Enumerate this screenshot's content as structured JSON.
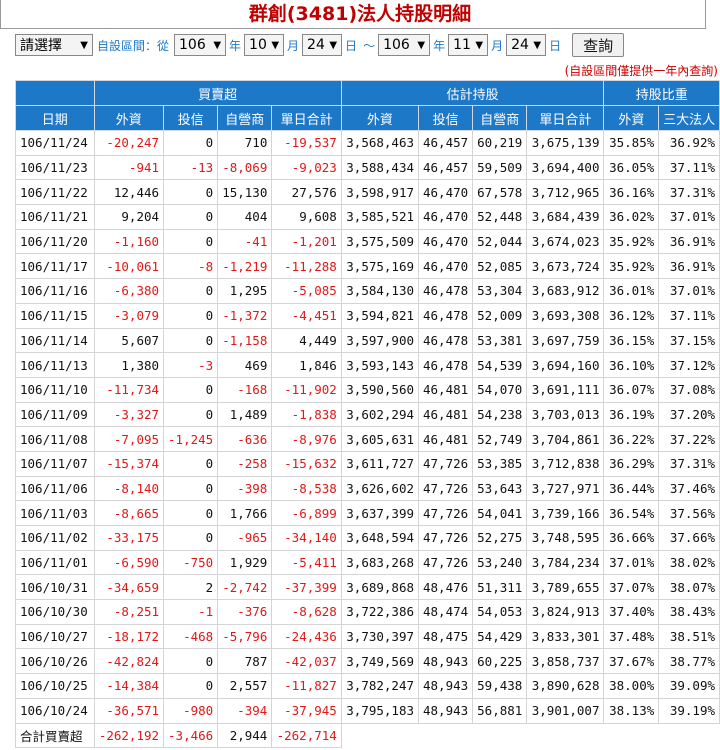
{
  "title": "群創(3481)法人持股明細",
  "controls": {
    "select_label": "請選擇",
    "range_label": "自設區間：從",
    "from_year": "106",
    "year_unit": "年",
    "from_month": "10",
    "month_unit": "月",
    "from_day": "24",
    "day_unit": "日",
    "tilde": "～",
    "to_year": "106",
    "to_month": "11",
    "to_day": "24",
    "search_button": "查詢",
    "note": "(自設區間僅提供一年內查詢)"
  },
  "table": {
    "group_headers": [
      "買賣超",
      "估計持股",
      "持股比重"
    ],
    "columns": [
      "日期",
      "外資",
      "投信",
      "自營商",
      "單日合計",
      "外資",
      "投信",
      "自營商",
      "單日合計",
      "外資",
      "三大法人"
    ],
    "rows": [
      [
        "106/11/24",
        "-20,247",
        "0",
        "710",
        "-19,537",
        "3,568,463",
        "46,457",
        "60,219",
        "3,675,139",
        "35.85%",
        "36.92%"
      ],
      [
        "106/11/23",
        "-941",
        "-13",
        "-8,069",
        "-9,023",
        "3,588,434",
        "46,457",
        "59,509",
        "3,694,400",
        "36.05%",
        "37.11%"
      ],
      [
        "106/11/22",
        "12,446",
        "0",
        "15,130",
        "27,576",
        "3,598,917",
        "46,470",
        "67,578",
        "3,712,965",
        "36.16%",
        "37.31%"
      ],
      [
        "106/11/21",
        "9,204",
        "0",
        "404",
        "9,608",
        "3,585,521",
        "46,470",
        "52,448",
        "3,684,439",
        "36.02%",
        "37.01%"
      ],
      [
        "106/11/20",
        "-1,160",
        "0",
        "-41",
        "-1,201",
        "3,575,509",
        "46,470",
        "52,044",
        "3,674,023",
        "35.92%",
        "36.91%"
      ],
      [
        "106/11/17",
        "-10,061",
        "-8",
        "-1,219",
        "-11,288",
        "3,575,169",
        "46,470",
        "52,085",
        "3,673,724",
        "35.92%",
        "36.91%"
      ],
      [
        "106/11/16",
        "-6,380",
        "0",
        "1,295",
        "-5,085",
        "3,584,130",
        "46,478",
        "53,304",
        "3,683,912",
        "36.01%",
        "37.01%"
      ],
      [
        "106/11/15",
        "-3,079",
        "0",
        "-1,372",
        "-4,451",
        "3,594,821",
        "46,478",
        "52,009",
        "3,693,308",
        "36.12%",
        "37.11%"
      ],
      [
        "106/11/14",
        "5,607",
        "0",
        "-1,158",
        "4,449",
        "3,597,900",
        "46,478",
        "53,381",
        "3,697,759",
        "36.15%",
        "37.15%"
      ],
      [
        "106/11/13",
        "1,380",
        "-3",
        "469",
        "1,846",
        "3,593,143",
        "46,478",
        "54,539",
        "3,694,160",
        "36.10%",
        "37.12%"
      ],
      [
        "106/11/10",
        "-11,734",
        "0",
        "-168",
        "-11,902",
        "3,590,560",
        "46,481",
        "54,070",
        "3,691,111",
        "36.07%",
        "37.08%"
      ],
      [
        "106/11/09",
        "-3,327",
        "0",
        "1,489",
        "-1,838",
        "3,602,294",
        "46,481",
        "54,238",
        "3,703,013",
        "36.19%",
        "37.20%"
      ],
      [
        "106/11/08",
        "-7,095",
        "-1,245",
        "-636",
        "-8,976",
        "3,605,631",
        "46,481",
        "52,749",
        "3,704,861",
        "36.22%",
        "37.22%"
      ],
      [
        "106/11/07",
        "-15,374",
        "0",
        "-258",
        "-15,632",
        "3,611,727",
        "47,726",
        "53,385",
        "3,712,838",
        "36.29%",
        "37.31%"
      ],
      [
        "106/11/06",
        "-8,140",
        "0",
        "-398",
        "-8,538",
        "3,626,602",
        "47,726",
        "53,643",
        "3,727,971",
        "36.44%",
        "37.46%"
      ],
      [
        "106/11/03",
        "-8,665",
        "0",
        "1,766",
        "-6,899",
        "3,637,399",
        "47,726",
        "54,041",
        "3,739,166",
        "36.54%",
        "37.56%"
      ],
      [
        "106/11/02",
        "-33,175",
        "0",
        "-965",
        "-34,140",
        "3,648,594",
        "47,726",
        "52,275",
        "3,748,595",
        "36.66%",
        "37.66%"
      ],
      [
        "106/11/01",
        "-6,590",
        "-750",
        "1,929",
        "-5,411",
        "3,683,268",
        "47,726",
        "53,240",
        "3,784,234",
        "37.01%",
        "38.02%"
      ],
      [
        "106/10/31",
        "-34,659",
        "2",
        "-2,742",
        "-37,399",
        "3,689,868",
        "48,476",
        "51,311",
        "3,789,655",
        "37.07%",
        "38.07%"
      ],
      [
        "106/10/30",
        "-8,251",
        "-1",
        "-376",
        "-8,628",
        "3,722,386",
        "48,474",
        "54,053",
        "3,824,913",
        "37.40%",
        "38.43%"
      ],
      [
        "106/10/27",
        "-18,172",
        "-468",
        "-5,796",
        "-24,436",
        "3,730,397",
        "48,475",
        "54,429",
        "3,833,301",
        "37.48%",
        "38.51%"
      ],
      [
        "106/10/26",
        "-42,824",
        "0",
        "787",
        "-42,037",
        "3,749,569",
        "48,943",
        "60,225",
        "3,858,737",
        "37.67%",
        "38.77%"
      ],
      [
        "106/10/25",
        "-14,384",
        "0",
        "2,557",
        "-11,827",
        "3,782,247",
        "48,943",
        "59,438",
        "3,890,628",
        "38.00%",
        "39.09%"
      ],
      [
        "106/10/24",
        "-36,571",
        "-980",
        "-394",
        "-37,945",
        "3,795,183",
        "48,943",
        "56,881",
        "3,901,007",
        "38.13%",
        "39.19%"
      ]
    ],
    "total_label": "合計買賣超",
    "totals": [
      "-262,192",
      "-3,466",
      "2,944",
      "-262,714"
    ]
  }
}
